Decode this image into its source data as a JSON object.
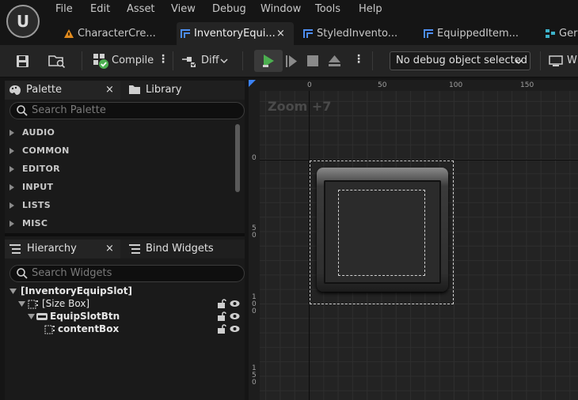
{
  "menu": [
    "File",
    "Edit",
    "Asset",
    "View",
    "Debug",
    "Window",
    "Tools",
    "Help"
  ],
  "tabs": [
    {
      "label": "CharacterCre...",
      "active": false,
      "icon": "widget-blueprint-icon"
    },
    {
      "label": "InventoryEqui...",
      "active": true,
      "icon": "widget-blueprint-icon"
    },
    {
      "label": "StyledInvento...",
      "active": false,
      "icon": "widget-blueprint-icon"
    },
    {
      "label": "EquippedItem...",
      "active": false,
      "icon": "widget-blueprint-icon"
    },
    {
      "label": "Ger",
      "active": false,
      "icon": "blueprint-icon"
    }
  ],
  "tab_close": "×",
  "toolbar": {
    "compile_label": "Compile",
    "diff_label": "Diff",
    "debug_selector": "No debug object selected",
    "right_label": "W"
  },
  "palette": {
    "tab_label": "Palette",
    "library_label": "Library",
    "close": "×",
    "search_placeholder": "Search Palette",
    "categories": [
      "AUDIO",
      "COMMON",
      "EDITOR",
      "INPUT",
      "LISTS",
      "MISC"
    ]
  },
  "hierarchy": {
    "tab_label": "Hierarchy",
    "close": "×",
    "bind_label": "Bind Widgets",
    "search_placeholder": "Search Widgets",
    "root": "[InventoryEquipSlot]",
    "items": [
      "[Size Box]",
      "EquipSlotBtn",
      "contentBox"
    ]
  },
  "designer": {
    "zoom_label": "Zoom +7",
    "ruler_top": [
      "0",
      "50",
      "100",
      "150"
    ],
    "ruler_left": [
      "0",
      "5\n0",
      "1\n0\n0",
      "1\n5\n0"
    ]
  },
  "colors": {
    "accent_blue": "#3b82f6",
    "play_green": "#4caf50",
    "tab_orange": "#e08a1e"
  }
}
